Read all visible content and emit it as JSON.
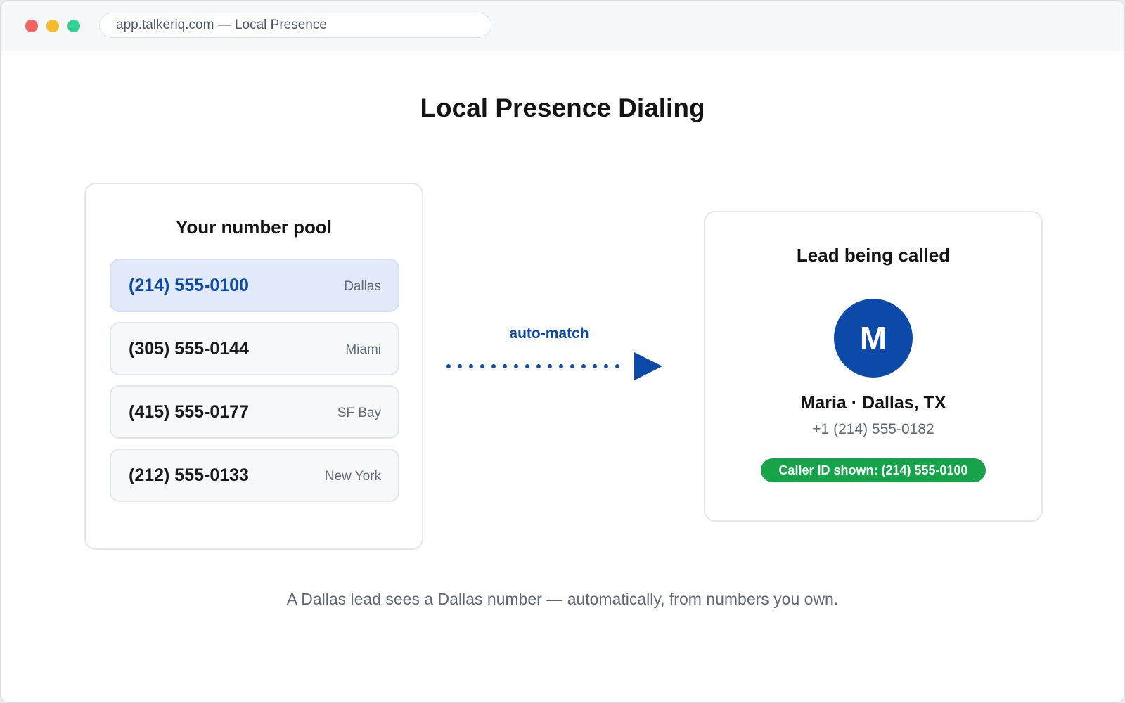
{
  "browser": {
    "url": "app.talkeriq.com — Local Presence"
  },
  "page": {
    "title": "Local Presence Dialing",
    "caption": "A Dallas lead sees a Dallas number — automatically, from numbers you own."
  },
  "pool": {
    "title": "Your number pool",
    "numbers": [
      {
        "number": "(214) 555-0100",
        "city": "Dallas",
        "selected": true
      },
      {
        "number": "(305) 555-0144",
        "city": "Miami",
        "selected": false
      },
      {
        "number": "(415) 555-0177",
        "city": "SF Bay",
        "selected": false
      },
      {
        "number": "(212) 555-0133",
        "city": "New York",
        "selected": false
      }
    ]
  },
  "match": {
    "label": "auto-match"
  },
  "lead": {
    "title": "Lead being called",
    "initial": "M",
    "name": "Maria · Dallas, TX",
    "phone": "+1 (214) 555-0182",
    "caller_id": "Caller ID shown: (214) 555-0100"
  },
  "colors": {
    "accent": "#0b4aa8",
    "success": "#16a34a",
    "selected_row": "#e2e9f8"
  }
}
